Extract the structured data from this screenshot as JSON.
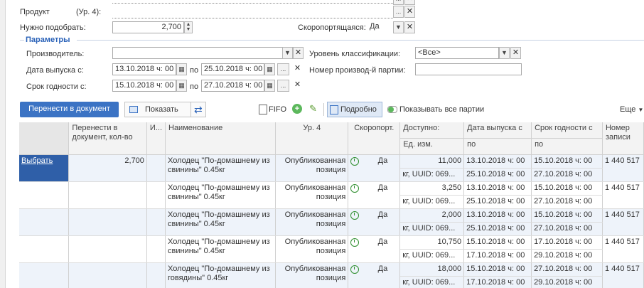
{
  "top": {
    "product_label": "Продукт",
    "product_level": "(Ур. 4):",
    "need_label": "Нужно подобрать:",
    "need_value": "2,700",
    "perishable_label": "Скоропортящаяся:",
    "perishable_value": "Да"
  },
  "params": {
    "title": "Параметры",
    "manufacturer_label": "Производитель:",
    "classification_label": "Уровень классификации:",
    "classification_value": "<Все>",
    "release_label": "Дата выпуска с:",
    "release_from": "13.10.2018  ч: 00",
    "release_to": "25.10.2018  ч: 00",
    "po": "по",
    "batch_label": "Номер производ-й партии:",
    "expiry_label": "Срок годности с:",
    "expiry_from": "15.10.2018  ч: 00",
    "expiry_to": "27.10.2018  ч: 00"
  },
  "toolbar": {
    "transfer_label": "Перенести в документ",
    "show_label": "Показать",
    "fifo_label": "FIFO",
    "detailed_label": "Подробно",
    "show_all_label": "Показывать все партии",
    "more_label": "Еще"
  },
  "table": {
    "headers": {
      "transfer": "Перенести в документ, кол-во",
      "i": "И...",
      "name": "Наименование",
      "level": "Ур. 4",
      "perishable": "Скоропорт.",
      "available": "Доступно:",
      "unit": "Ед. изм.",
      "release": "Дата выпуска с",
      "release_to": "по",
      "expiry": "Срок годности с",
      "expiry_to": "по",
      "record": "Номер записи"
    },
    "rows": [
      {
        "choose": "Выбрать",
        "qty": "2,700",
        "name": "Холодец \"По-домашнему из свинины\" 0.45кг",
        "level": "Опубликованная позиция",
        "perishable": "Да",
        "available": "11,000",
        "unit": "кг, UUID: 069...",
        "rel_from": "13.10.2018  ч: 00",
        "rel_to": "25.10.2018  ч: 00",
        "exp_from": "15.10.2018  ч: 00",
        "exp_to": "27.10.2018  ч: 00",
        "record": "1 440 517"
      },
      {
        "choose": "",
        "qty": "",
        "name": "Холодец \"По-домашнему из свинины\" 0.45кг",
        "level": "Опубликованная позиция",
        "perishable": "Да",
        "available": "3,250",
        "unit": "кг, UUID: 069...",
        "rel_from": "13.10.2018  ч: 00",
        "rel_to": "25.10.2018  ч: 00",
        "exp_from": "15.10.2018  ч: 00",
        "exp_to": "27.10.2018  ч: 00",
        "record": "1 440 517"
      },
      {
        "choose": "",
        "qty": "",
        "name": "Холодец \"По-домашнему из свинины\" 0.45кг",
        "level": "Опубликованная позиция",
        "perishable": "Да",
        "available": "2,000",
        "unit": "кг, UUID: 069...",
        "rel_from": "13.10.2018  ч: 00",
        "rel_to": "25.10.2018  ч: 00",
        "exp_from": "15.10.2018  ч: 00",
        "exp_to": "27.10.2018  ч: 00",
        "record": "1 440 517"
      },
      {
        "choose": "",
        "qty": "",
        "name": "Холодец \"По-домашнему из свинины\" 0.45кг",
        "level": "Опубликованная позиция",
        "perishable": "Да",
        "available": "10,750",
        "unit": "кг, UUID: 069...",
        "rel_from": "15.10.2018  ч: 00",
        "rel_to": "17.10.2018  ч: 00",
        "exp_from": "17.10.2018  ч: 00",
        "exp_to": "29.10.2018  ч: 00",
        "record": "1 440 517"
      },
      {
        "choose": "",
        "qty": "",
        "name": "Холодец \"По-домашнему из говядины\" 0.45кг",
        "level": "Опубликованная позиция",
        "perishable": "Да",
        "available": "18,000",
        "unit": "кг, UUID: 069...",
        "rel_from": "15.10.2018  ч: 00",
        "rel_to": "17.10.2018  ч: 00",
        "exp_from": "27.10.2018  ч: 00",
        "exp_to": "29.10.2018  ч: 00",
        "record": "1 440 517"
      }
    ]
  }
}
